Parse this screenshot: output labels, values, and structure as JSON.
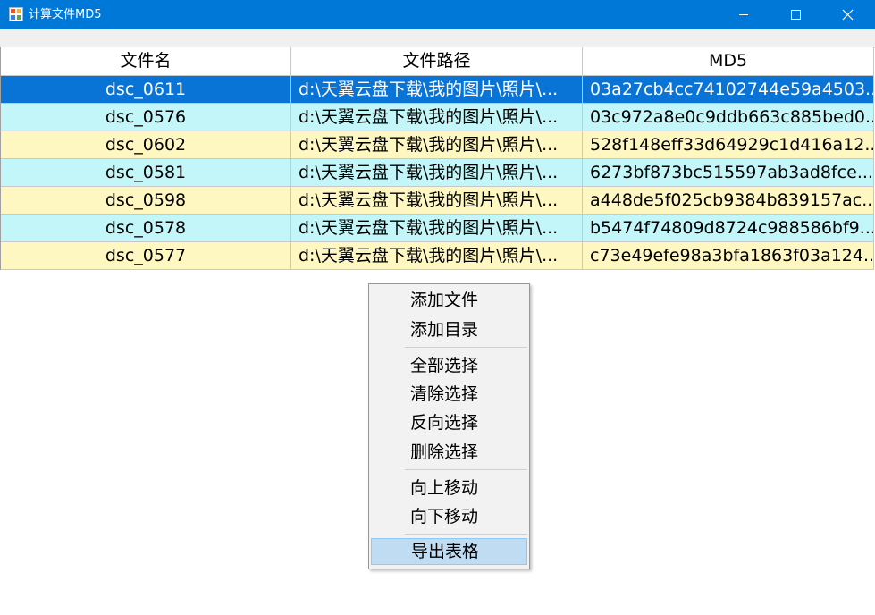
{
  "window": {
    "title": "计算文件MD5",
    "icon": "app-window-icon"
  },
  "grid": {
    "columns": [
      "文件名",
      "文件路径",
      "MD5"
    ],
    "rows": [
      {
        "name": "dsc_0611",
        "path": "d:\\天翼云盘下载\\我的图片\\照片\\...",
        "md5": "03a27cb4cc74102744e59a4503...",
        "style": "selected"
      },
      {
        "name": "dsc_0576",
        "path": "d:\\天翼云盘下载\\我的图片\\照片\\...",
        "md5": "03c972a8e0c9ddb663c885bed0...",
        "style": "cyan"
      },
      {
        "name": "dsc_0602",
        "path": "d:\\天翼云盘下载\\我的图片\\照片\\...",
        "md5": "528f148eff33d64929c1d416a12...",
        "style": "yellow"
      },
      {
        "name": "dsc_0581",
        "path": "d:\\天翼云盘下载\\我的图片\\照片\\...",
        "md5": "6273bf873bc515597ab3ad8fce...",
        "style": "cyan"
      },
      {
        "name": "dsc_0598",
        "path": "d:\\天翼云盘下载\\我的图片\\照片\\...",
        "md5": "a448de5f025cb9384b839157ac...",
        "style": "yellow"
      },
      {
        "name": "dsc_0578",
        "path": "d:\\天翼云盘下载\\我的图片\\照片\\...",
        "md5": "b5474f74809d8724c988586bf9...",
        "style": "cyan"
      },
      {
        "name": "dsc_0577",
        "path": "d:\\天翼云盘下载\\我的图片\\照片\\...",
        "md5": "c73e49efe98a3bfa1863f03a124...",
        "style": "yellow"
      }
    ]
  },
  "context_menu": {
    "add_file": "添加文件",
    "add_dir": "添加目录",
    "select_all": "全部选择",
    "clear_selection": "清除选择",
    "invert_selection": "反向选择",
    "delete_selection": "删除选择",
    "move_up": "向上移动",
    "move_down": "向下移动",
    "export_table": "导出表格",
    "hovered_item": "export_table"
  },
  "colors": {
    "titlebar": "#0078d7",
    "selected_row": "#0a74d6",
    "cyan_row": "#c2f6f8",
    "yellow_row": "#fff7c2",
    "menu_hover": "#c0dcf3"
  }
}
